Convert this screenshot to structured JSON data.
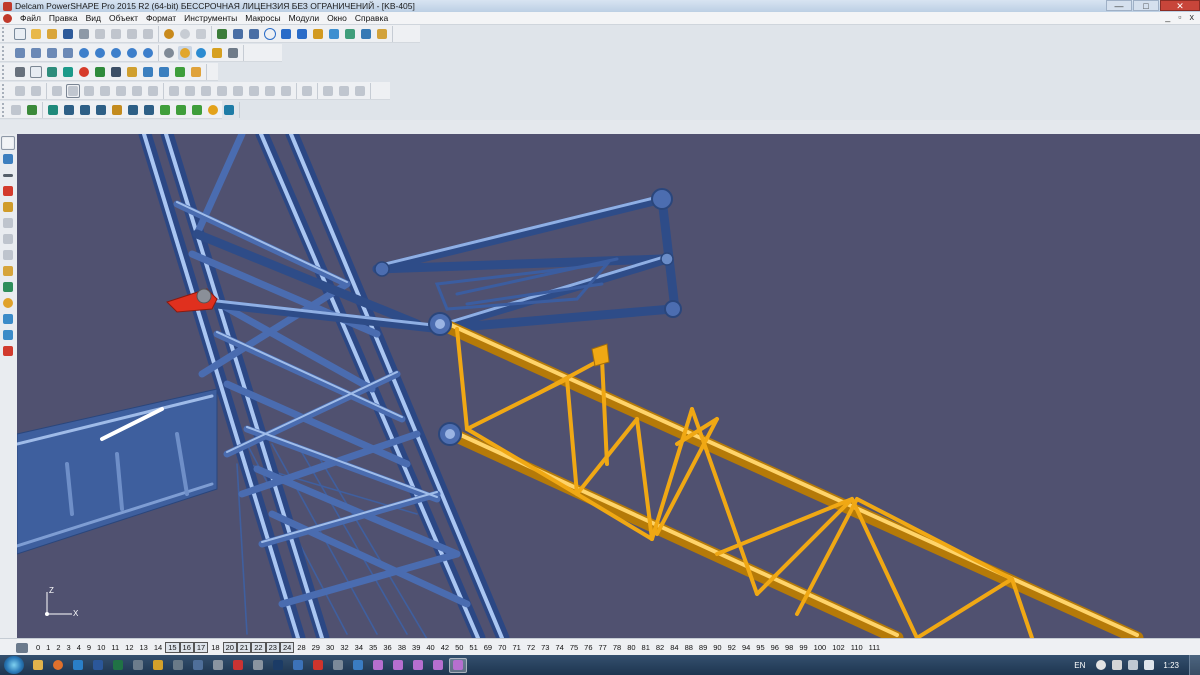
{
  "window": {
    "title": "Delcam PowerSHAPE Pro 2015 R2 (64-bit) БЕССРОЧНАЯ ЛИЦЕНЗИЯ БЕЗ ОГРАНИЧЕНИЙ - [KB-405]",
    "minimize": "—",
    "maximize": "□",
    "close": "✕"
  },
  "menu": {
    "items": [
      "Файл",
      "Правка",
      "Вид",
      "Объект",
      "Формат",
      "Инструменты",
      "Макросы",
      "Модули",
      "Окно",
      "Справка"
    ],
    "mdi_minimize": "_",
    "mdi_restore": "▫",
    "mdi_close": "x"
  },
  "levels": {
    "items": [
      {
        "label": "0",
        "on": false
      },
      {
        "label": "1",
        "on": false
      },
      {
        "label": "2",
        "on": false
      },
      {
        "label": "3",
        "on": false
      },
      {
        "label": "4",
        "on": false
      },
      {
        "label": "9",
        "on": false
      },
      {
        "label": "10",
        "on": false
      },
      {
        "label": "11",
        "on": false
      },
      {
        "label": "12",
        "on": false
      },
      {
        "label": "13",
        "on": false
      },
      {
        "label": "14",
        "on": false
      },
      {
        "label": "15",
        "on": true
      },
      {
        "label": "16",
        "on": true
      },
      {
        "label": "17",
        "on": true
      },
      {
        "label": "18",
        "on": false
      },
      {
        "label": "20",
        "on": true
      },
      {
        "label": "21",
        "on": true
      },
      {
        "label": "22",
        "on": true
      },
      {
        "label": "23",
        "on": true
      },
      {
        "label": "24",
        "on": true
      },
      {
        "label": "28",
        "on": false
      },
      {
        "label": "29",
        "on": false
      },
      {
        "label": "30",
        "on": false
      },
      {
        "label": "32",
        "on": false
      },
      {
        "label": "34",
        "on": false
      },
      {
        "label": "35",
        "on": false
      },
      {
        "label": "36",
        "on": false
      },
      {
        "label": "38",
        "on": false
      },
      {
        "label": "39",
        "on": false
      },
      {
        "label": "40",
        "on": false
      },
      {
        "label": "42",
        "on": false
      },
      {
        "label": "50",
        "on": false
      },
      {
        "label": "51",
        "on": false
      },
      {
        "label": "69",
        "on": false
      },
      {
        "label": "70",
        "on": false
      },
      {
        "label": "71",
        "on": false
      },
      {
        "label": "72",
        "on": false
      },
      {
        "label": "73",
        "on": false
      },
      {
        "label": "74",
        "on": false
      },
      {
        "label": "75",
        "on": false
      },
      {
        "label": "76",
        "on": false
      },
      {
        "label": "77",
        "on": false
      },
      {
        "label": "78",
        "on": false
      },
      {
        "label": "80",
        "on": false
      },
      {
        "label": "81",
        "on": false
      },
      {
        "label": "82",
        "on": false
      },
      {
        "label": "84",
        "on": false
      },
      {
        "label": "88",
        "on": false
      },
      {
        "label": "89",
        "on": false
      },
      {
        "label": "90",
        "on": false
      },
      {
        "label": "92",
        "on": false
      },
      {
        "label": "94",
        "on": false
      },
      {
        "label": "95",
        "on": false
      },
      {
        "label": "96",
        "on": false
      },
      {
        "label": "98",
        "on": false
      },
      {
        "label": "99",
        "on": false
      },
      {
        "label": "100",
        "on": false
      },
      {
        "label": "102",
        "on": false
      },
      {
        "label": "110",
        "on": false
      },
      {
        "label": "111",
        "on": false
      }
    ]
  },
  "axis": {
    "x": "X",
    "z": "Z"
  },
  "tray": {
    "language": "EN",
    "clock": "1:23"
  },
  "colors": {
    "viewport_bg": "#505170",
    "tower_blue": "#4f74b8",
    "tower_highlight": "#a9c3ef",
    "boom_yellow": "#f0a814",
    "boom_highlight": "#ffd76a",
    "red_part": "#e0301e"
  }
}
